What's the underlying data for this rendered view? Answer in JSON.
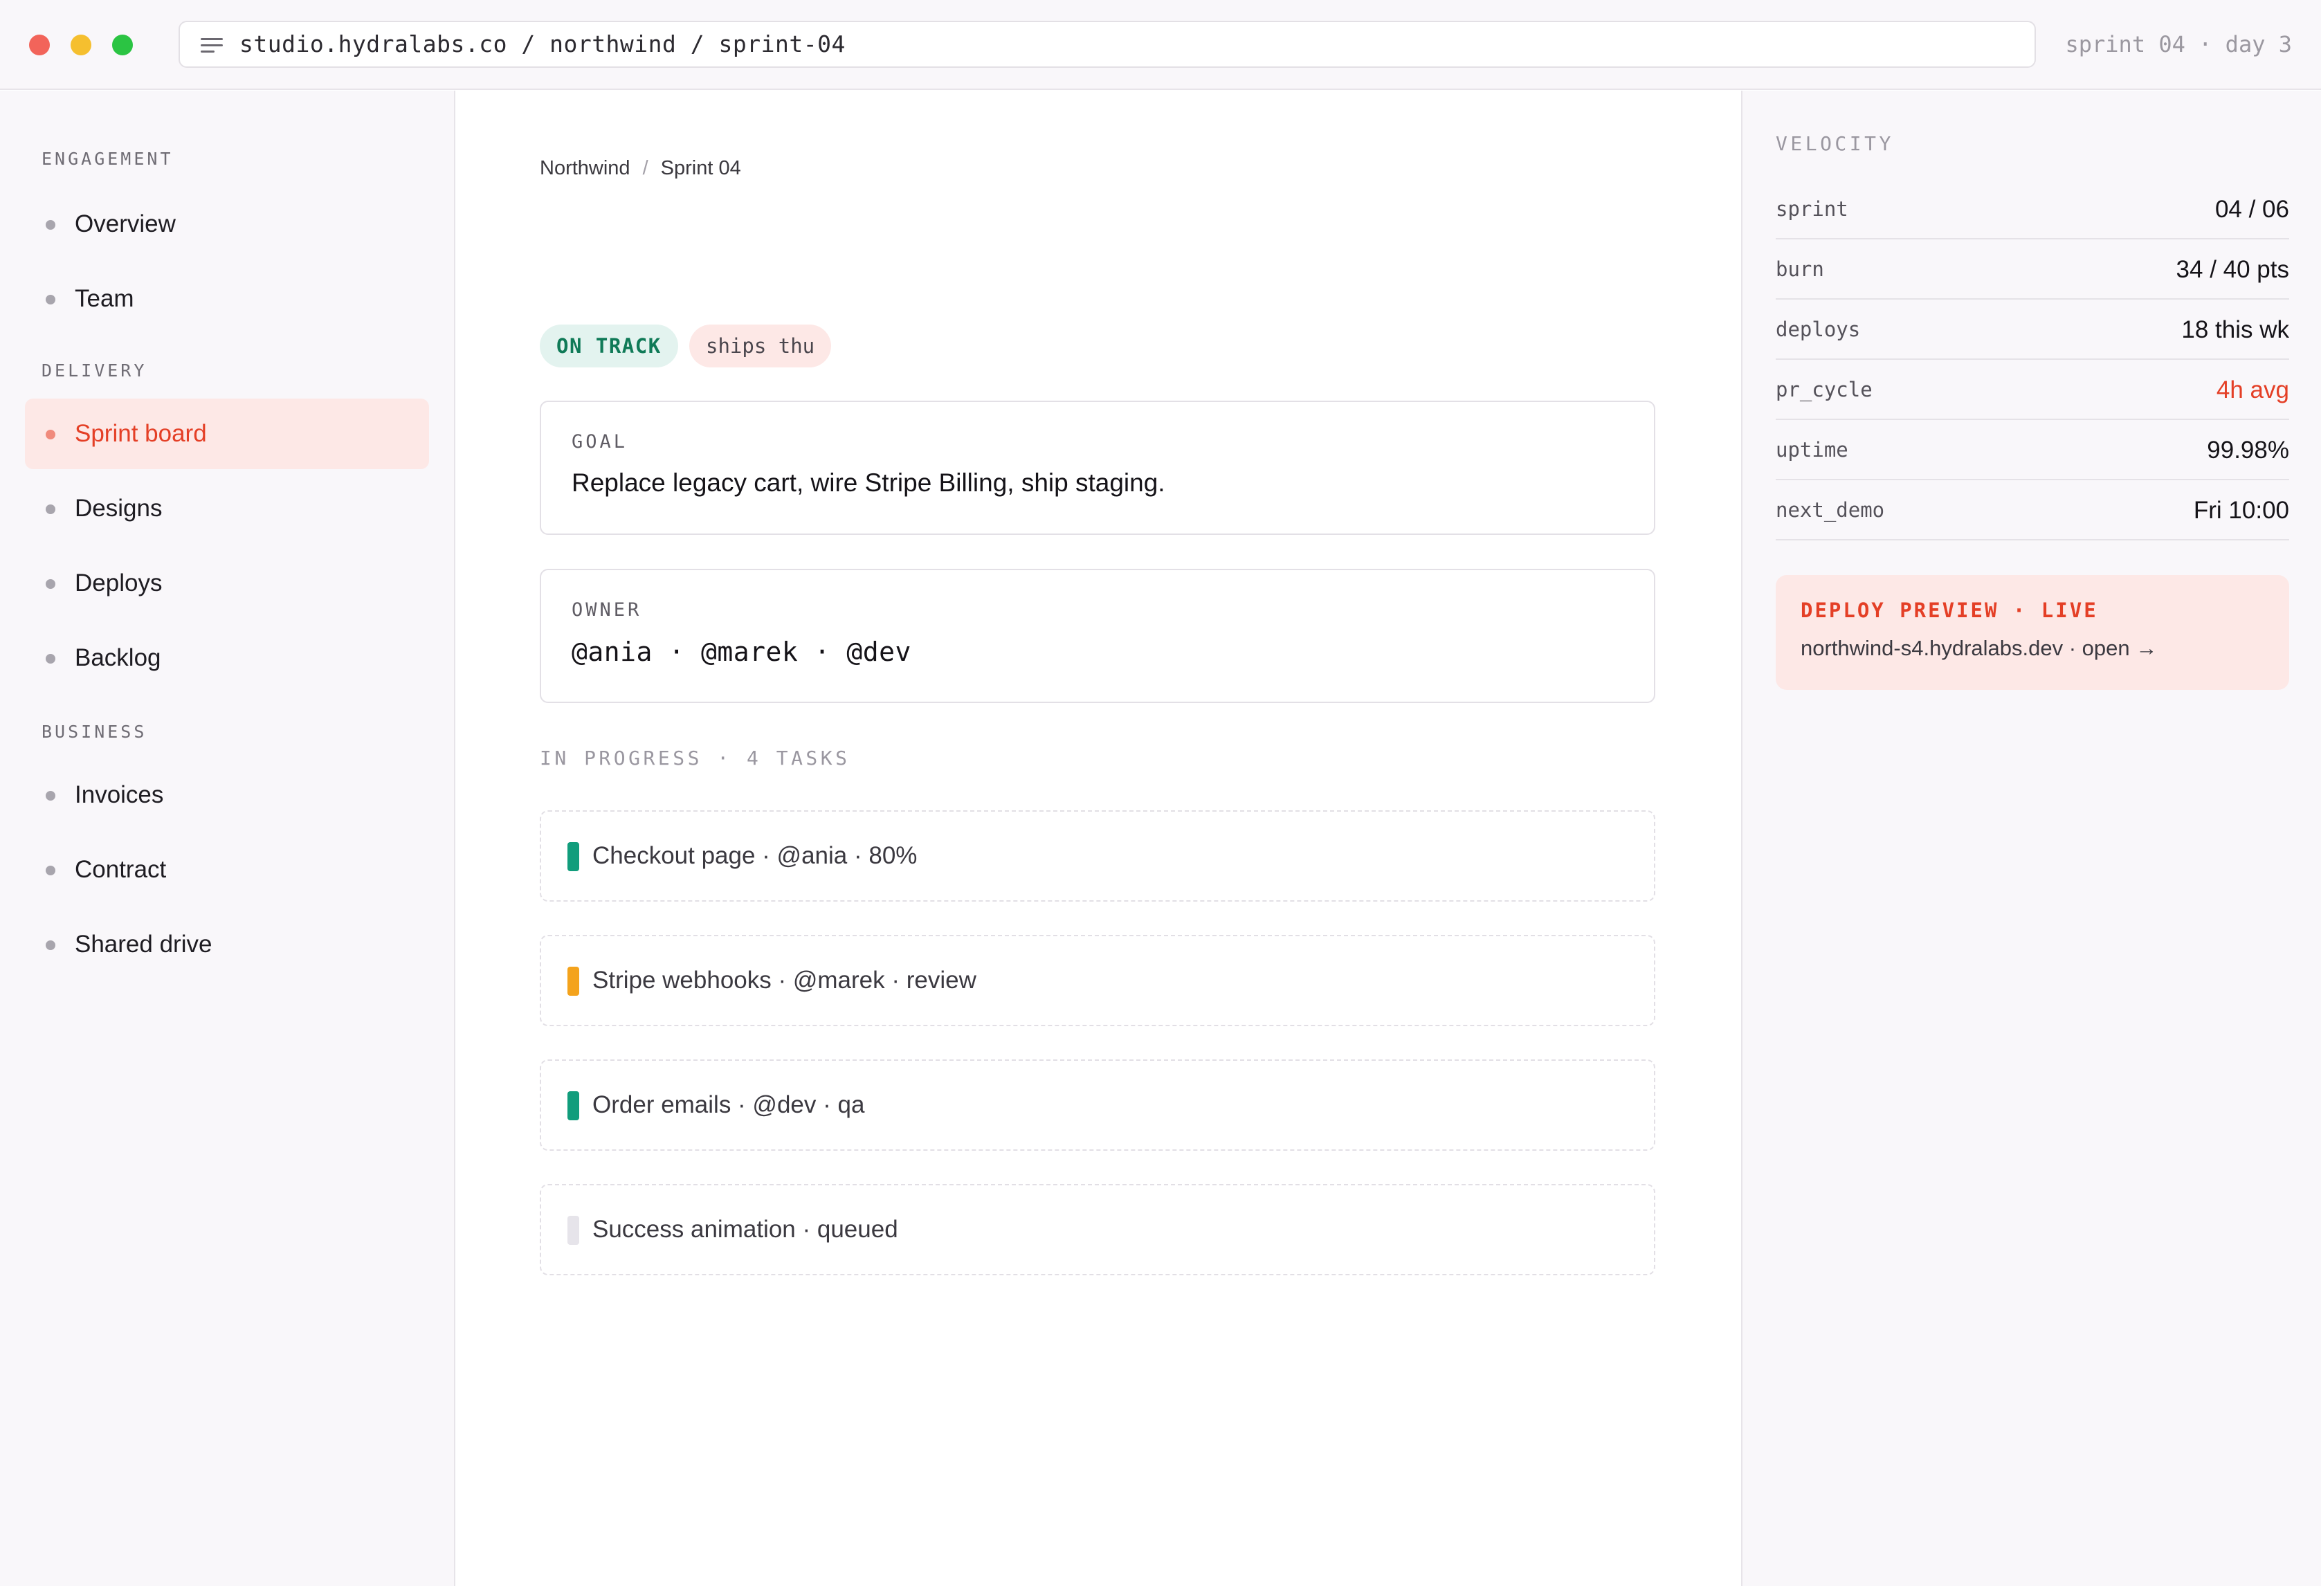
{
  "window": {
    "url": "studio.hydralabs.co / northwind / sprint-04",
    "sprint_day": "sprint 04 · day 3"
  },
  "sidebar": {
    "sections": [
      {
        "label": "ENGAGEMENT",
        "items": [
          {
            "label": "Overview"
          },
          {
            "label": "Team"
          }
        ]
      },
      {
        "label": "DELIVERY",
        "items": [
          {
            "label": "Sprint board",
            "active": true
          },
          {
            "label": "Designs"
          },
          {
            "label": "Deploys"
          },
          {
            "label": "Backlog"
          }
        ]
      },
      {
        "label": "BUSINESS",
        "items": [
          {
            "label": "Invoices"
          },
          {
            "label": "Contract"
          },
          {
            "label": "Shared drive"
          }
        ]
      }
    ]
  },
  "main": {
    "breadcrumb": {
      "parent": "Northwind",
      "separator": "/",
      "current": "Sprint 04"
    },
    "badges": {
      "status": "ON TRACK",
      "ship": "ships thu"
    },
    "goal": {
      "label": "GOAL",
      "value": "Replace legacy cart, wire Stripe Billing, ship staging."
    },
    "owner": {
      "label": "OWNER",
      "value": "@ania · @marek · @dev"
    },
    "in_progress": {
      "heading": "IN PROGRESS · 4 TASKS",
      "tasks": [
        {
          "text": "Checkout page · @ania · 80%",
          "color": "#119d7c"
        },
        {
          "text": "Stripe webhooks · @marek · review",
          "color": "#f4a31c"
        },
        {
          "text": "Order emails · @dev · qa",
          "color": "#119d7c"
        },
        {
          "text": "Success animation · queued",
          "color": "#e6e4ea"
        }
      ]
    }
  },
  "velocity": {
    "title": "VELOCITY",
    "rows": [
      {
        "key": "sprint",
        "value": "04 / 06"
      },
      {
        "key": "burn",
        "value": "34 / 40 pts"
      },
      {
        "key": "deploys",
        "value": "18 this wk"
      },
      {
        "key": "pr_cycle",
        "value": "4h avg",
        "alert": true
      },
      {
        "key": "uptime",
        "value": "99.98%"
      },
      {
        "key": "next_demo",
        "value": "Fri 10:00"
      }
    ]
  },
  "deploy_preview": {
    "title": "DEPLOY PREVIEW · LIVE",
    "link": "northwind-s4.hydralabs.dev · open →"
  },
  "colors": {
    "accent": "#e43f26",
    "accent_bg": "#fde8e6",
    "success": "#0f7a57",
    "success_bg": "#e3f3ef"
  }
}
